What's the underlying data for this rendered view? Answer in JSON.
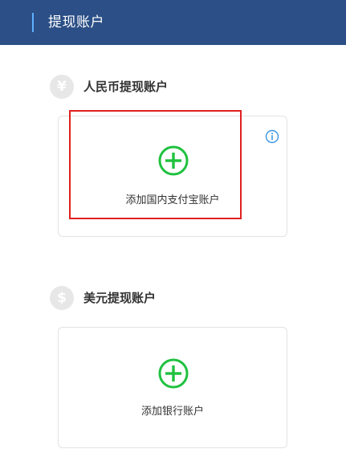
{
  "header": {
    "title": "提现账户"
  },
  "sections": {
    "rmb": {
      "icon_glyph": "¥",
      "icon_name": "yen-icon",
      "title": "人民币提现账户",
      "card": {
        "label": "添加国内支付宝账户",
        "info_icon": "info-icon",
        "plus_icon": "plus-circle-icon"
      }
    },
    "usd": {
      "icon_glyph": "$",
      "icon_name": "dollar-icon",
      "title": "美元提现账户",
      "card": {
        "label": "添加银行账户",
        "plus_icon": "plus-circle-icon"
      }
    }
  },
  "colors": {
    "header_bg": "#2b4f86",
    "header_accent": "#5fb1ff",
    "plus_green": "#1fc13f",
    "info_blue": "#3a95e6",
    "highlight_red": "#e02020",
    "card_border": "#e3e3e3",
    "coin_bg": "#e7e7e7"
  }
}
